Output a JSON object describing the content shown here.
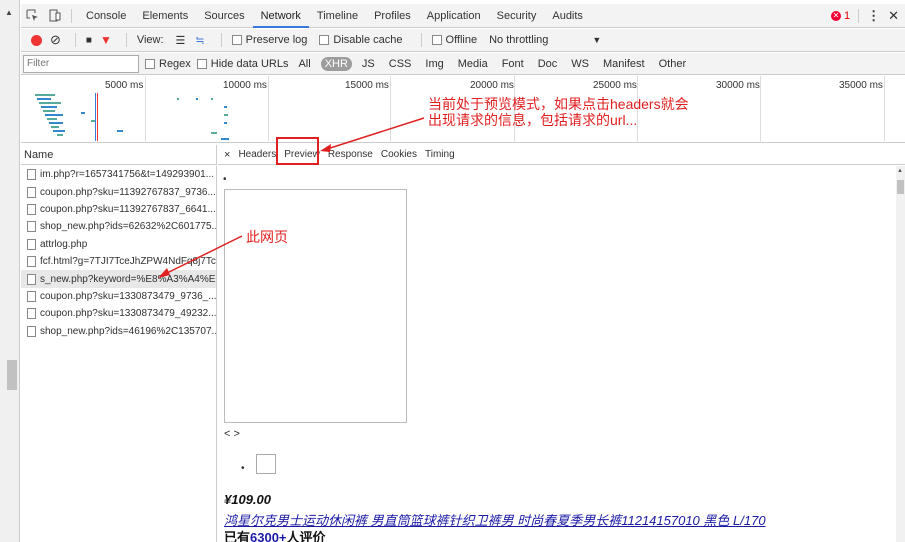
{
  "tabbar": {
    "tabs": [
      "Console",
      "Elements",
      "Sources",
      "Network",
      "Timeline",
      "Profiles",
      "Application",
      "Security",
      "Audits"
    ],
    "active_tab": "Network",
    "error_count": "1"
  },
  "toolbar": {
    "view_label": "View:",
    "preserve_log": "Preserve log",
    "disable_cache": "Disable cache",
    "offline": "Offline",
    "throttling": "No throttling"
  },
  "filterbar": {
    "placeholder": "Filter",
    "regex": "Regex",
    "hide_data_urls": "Hide data URLs",
    "types": [
      "All",
      "XHR",
      "JS",
      "CSS",
      "Img",
      "Media",
      "Font",
      "Doc",
      "WS",
      "Manifest",
      "Other"
    ],
    "active_type": "XHR"
  },
  "overview": {
    "ticks": [
      "5000 ms",
      "10000 ms",
      "15000 ms",
      "20000 ms",
      "25000 ms",
      "30000 ms",
      "35000 ms"
    ]
  },
  "list": {
    "header": "Name",
    "requests": [
      "im.php?r=1657341756&t=149293901...",
      "coupon.php?sku=11392767837_9736...",
      "coupon.php?sku=11392767837_6641...",
      "shop_new.php?ids=62632%2C601775...",
      "attrlog.php",
      "fcf.html?g=7TJI7TceJhZPW4NdFq8j7Tc...",
      "s_new.php?keyword=%E8%A3%A4%E...",
      "coupon.php?sku=1330873479_9736_...",
      "coupon.php?sku=1330873479_49232...",
      "shop_new.php?ids=46196%2C135707..."
    ]
  },
  "detail": {
    "tabs": [
      "Headers",
      "Preview",
      "Response",
      "Cookies",
      "Timing"
    ],
    "active_tab": "Preview"
  },
  "preview": {
    "bullet": "•",
    "pager": "< >",
    "price": "¥109.00",
    "product_link": "鸿星尔克男士运动休闲裤 男直筒篮球裤针织卫裤男 时尚春夏季男长裤11214157010 黑色 L/170",
    "rating_prefix": "已有",
    "rating_count": "6300+",
    "rating_suffix": "人评价"
  },
  "annotations": {
    "preview_note_line1": "当前处于预览模式，如果点击headers就会",
    "preview_note_line2": "出现请求的信息，包括请求的url...",
    "page_note": "此网页"
  },
  "colors": {
    "annotation_red": "#e02020",
    "record_red": "#e33",
    "link_blue": "#1a1aa6",
    "active_tab_blue": "#3879d9"
  }
}
